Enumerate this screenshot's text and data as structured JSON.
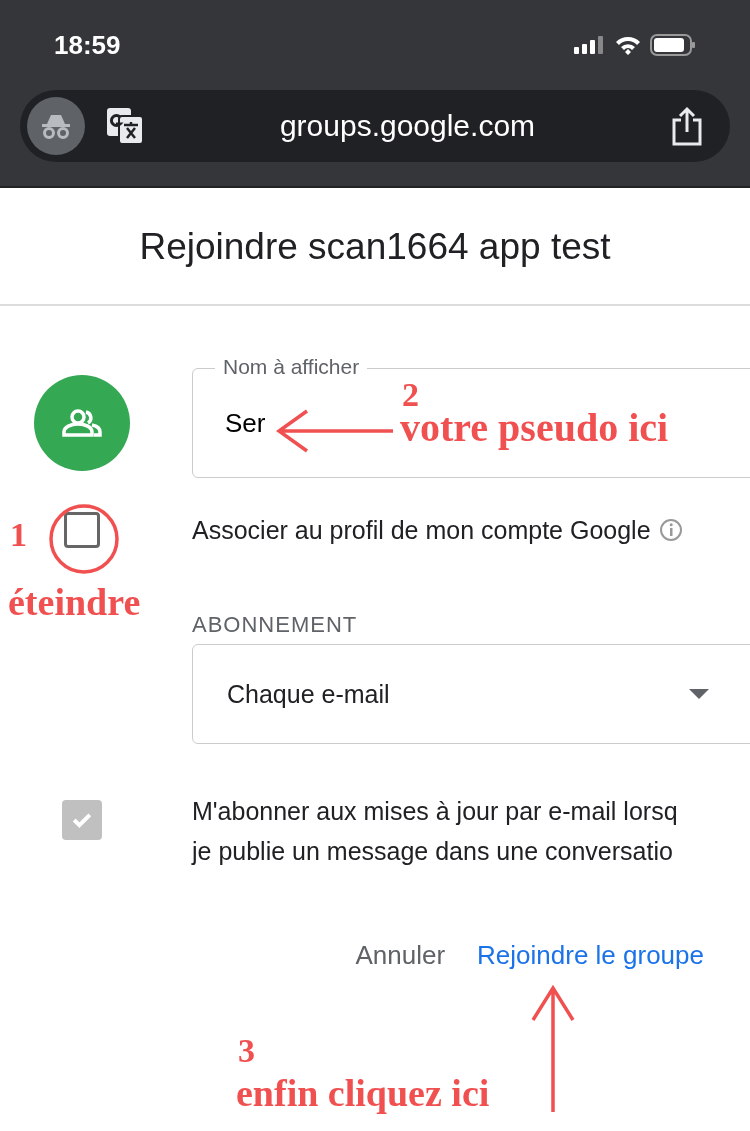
{
  "status_bar": {
    "time": "18:59"
  },
  "browser": {
    "url": "groups.google.com"
  },
  "page": {
    "title": "Rejoindre scan1664 app test"
  },
  "form": {
    "display_name": {
      "label": "Nom à afficher",
      "value": "Ser"
    },
    "profile_checkbox": {
      "label": "Associer au profil de mon compte Google",
      "checked": false,
      "disabled": false
    },
    "subscription": {
      "heading": "ABONNEMENT",
      "value": "Chaque e-mail"
    },
    "updates_checkbox": {
      "lines": [
        "M'abonner aux mises à jour par e-mail lorsq",
        "je publie un message dans une conversatio"
      ],
      "checked": true,
      "disabled": true
    },
    "buttons": [
      {
        "label": "Annuler",
        "kind": "secondary"
      },
      {
        "label": "Rejoindre le groupe",
        "kind": "primary"
      }
    ]
  },
  "annotations": [
    {
      "number": "1",
      "text": "éteindre",
      "kind": "circle"
    },
    {
      "number": "2",
      "text": "votre pseudo ici",
      "kind": "left-arrow"
    },
    {
      "number": "3",
      "text": "enfin cliquez ici",
      "kind": "up-arrow"
    }
  ]
}
